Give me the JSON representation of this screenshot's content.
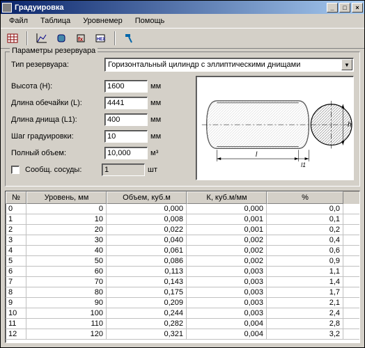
{
  "window": {
    "title": "Градуировка"
  },
  "menu": {
    "file": "Файл",
    "table": "Таблица",
    "level": "Уровнемер",
    "help": "Помощь"
  },
  "groupbox": {
    "title": "Параметры резервуара"
  },
  "labels": {
    "tank_type": "Тип резервуара:",
    "height": "Высота (H):",
    "shell": "Длина обечайки (L):",
    "bottom": "Длина днища (L1):",
    "step": "Шаг градуировки:",
    "fullvol": "Полный объем:",
    "vessels": "Сообщ. сосуды:"
  },
  "values": {
    "tank_type": "Горизонтальный цилиндр с эллиптическими днищами",
    "height": "1600",
    "shell": "4441",
    "bottom": "400",
    "step": "10",
    "fullvol": "10,000",
    "vessels": "1"
  },
  "units": {
    "mm": "мм",
    "m3": "м³",
    "pcs": "шт"
  },
  "grid": {
    "headers": {
      "n": "№",
      "level": "Уровень, мм",
      "volume": "Объем, куб.м",
      "k": "К, куб.м/мм",
      "pct": "%"
    },
    "rows": [
      {
        "n": "0",
        "l": "0",
        "v": "0,000",
        "k": "0,000",
        "p": "0,0"
      },
      {
        "n": "1",
        "l": "10",
        "v": "0,008",
        "k": "0,001",
        "p": "0,1"
      },
      {
        "n": "2",
        "l": "20",
        "v": "0,022",
        "k": "0,001",
        "p": "0,2"
      },
      {
        "n": "3",
        "l": "30",
        "v": "0,040",
        "k": "0,002",
        "p": "0,4"
      },
      {
        "n": "4",
        "l": "40",
        "v": "0,061",
        "k": "0,002",
        "p": "0,6"
      },
      {
        "n": "5",
        "l": "50",
        "v": "0,086",
        "k": "0,002",
        "p": "0,9"
      },
      {
        "n": "6",
        "l": "60",
        "v": "0,113",
        "k": "0,003",
        "p": "1,1"
      },
      {
        "n": "7",
        "l": "70",
        "v": "0,143",
        "k": "0,003",
        "p": "1,4"
      },
      {
        "n": "8",
        "l": "80",
        "v": "0,175",
        "k": "0,003",
        "p": "1,7"
      },
      {
        "n": "9",
        "l": "90",
        "v": "0,209",
        "k": "0,003",
        "p": "2,1"
      },
      {
        "n": "10",
        "l": "100",
        "v": "0,244",
        "k": "0,003",
        "p": "2,4"
      },
      {
        "n": "11",
        "l": "110",
        "v": "0,282",
        "k": "0,004",
        "p": "2,8"
      },
      {
        "n": "12",
        "l": "120",
        "v": "0,321",
        "k": "0,004",
        "p": "3,2"
      }
    ]
  },
  "diagram": {
    "L": "l",
    "L1": "l1",
    "H": "h"
  }
}
